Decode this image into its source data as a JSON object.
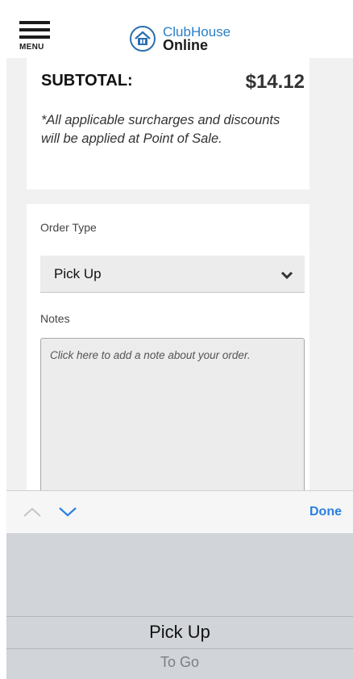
{
  "header": {
    "menu_label": "MENU",
    "logo_top": "ClubHouse",
    "logo_bottom": "Online",
    "logo_icon": "house-icon"
  },
  "subtotal": {
    "label": "SUBTOTAL:",
    "value": "$14.12",
    "note": "*All applicable surcharges and discounts will be applied at Point of Sale."
  },
  "order": {
    "type_label": "Order Type",
    "selected": "Pick Up",
    "notes_label": "Notes",
    "notes_placeholder": "Click here to add a note about your order."
  },
  "accessory": {
    "done_label": "Done",
    "prev_icon": "chevron-up-icon",
    "next_icon": "chevron-down-icon"
  },
  "picker": {
    "options": [
      "Pick Up",
      "To Go"
    ],
    "selected": "Pick Up"
  },
  "colors": {
    "accent": "#2b7fe0",
    "brand_blue": "#2a7fc7",
    "picker_bg": "#d1d4d9"
  }
}
